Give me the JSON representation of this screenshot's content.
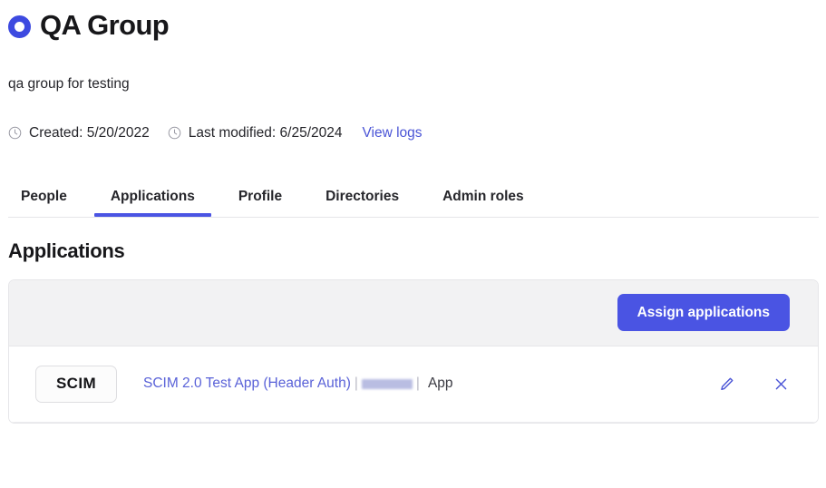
{
  "header": {
    "icon": "group-ring-icon",
    "title": "QA Group",
    "accent_color": "#4a54e3"
  },
  "description": "qa group for testing",
  "meta": {
    "clock_icon": "clock-icon",
    "created_label": "Created: 5/20/2022",
    "modified_label": "Last modified: 6/25/2024",
    "view_logs_label": "View logs",
    "link_color": "#4a54d6"
  },
  "tabs": [
    {
      "label": "People",
      "active": false
    },
    {
      "label": "Applications",
      "active": true
    },
    {
      "label": "Profile",
      "active": false
    },
    {
      "label": "Directories",
      "active": false
    },
    {
      "label": "Admin roles",
      "active": false
    }
  ],
  "section": {
    "title": "Applications"
  },
  "toolbar": {
    "assign_label": "Assign applications",
    "button_color": "#4a54e3"
  },
  "applications": [
    {
      "logo_text": "SCIM",
      "link_text": "SCIM 2.0 Test App (Header Auth)",
      "separator": "|",
      "redacted": "",
      "separator2": "|",
      "suffix": "App",
      "edit_icon": "pencil-icon",
      "remove_icon": "close-icon"
    }
  ]
}
